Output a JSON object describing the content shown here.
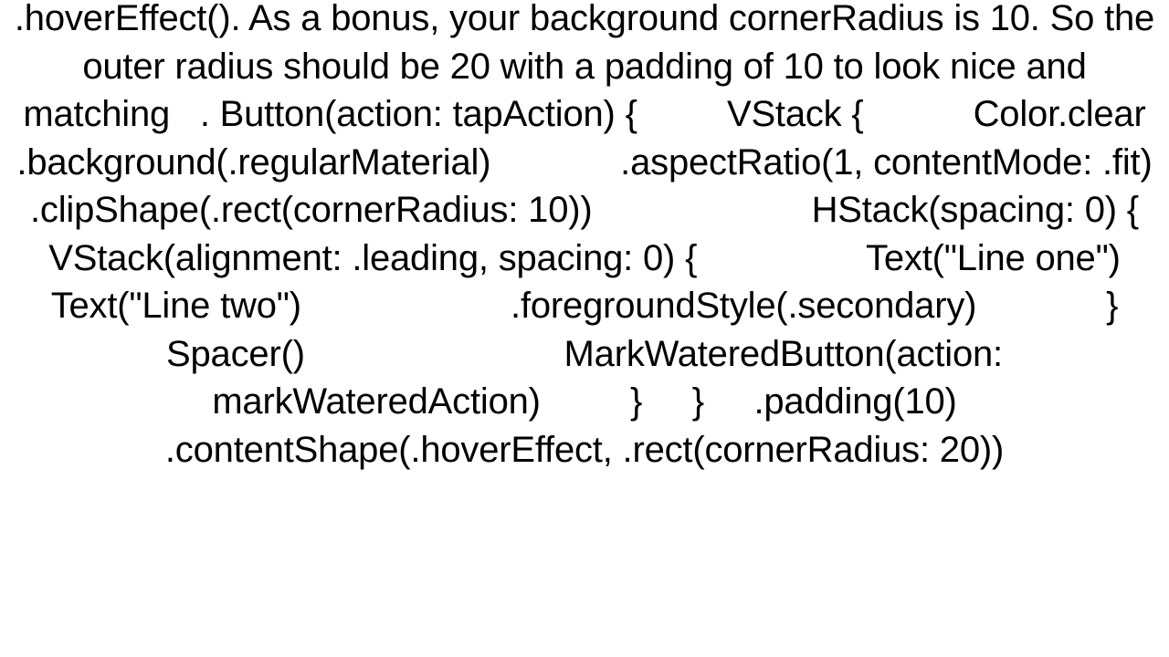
{
  "document": {
    "text": ".hoverEffect(). As a bonus, your background cornerRadius is 10. So the outer radius should be 20 with a padding of 10 to look nice and matching   . Button(action: tapAction) {         VStack {           Color.clear             .background(.regularMaterial)             .aspectRatio(1, contentMode: .fit)             .clipShape(.rect(cornerRadius: 10))                      HStack(spacing: 0) {             VStack(alignment: .leading, spacing: 0) {                 Text(\"Line one\")                 Text(\"Line two\")                     .foregroundStyle(.secondary)             }             Spacer()                          MarkWateredButton(action: markWateredAction)         }     }     .padding(10)     .contentShape(.hoverEffect, .rect(cornerRadius: 20))"
  }
}
